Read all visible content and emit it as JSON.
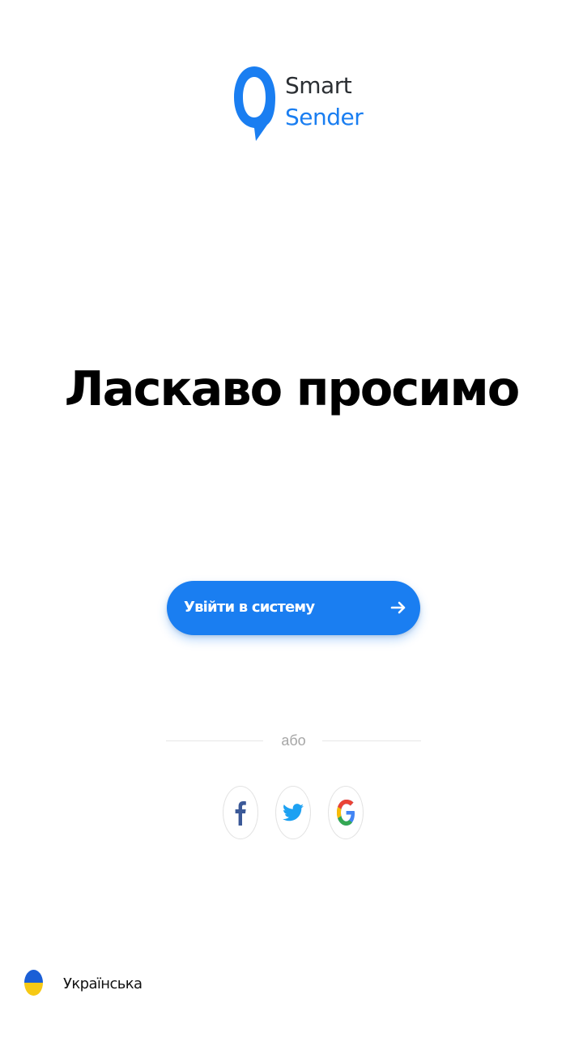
{
  "logo": {
    "line1": "Smart",
    "line2": "Sender",
    "icon": "speech-bubble-logo-icon",
    "brand_color": "#1a7ef1"
  },
  "headline": "Ласкаво просимо",
  "login_button": {
    "label": "Увійти в систему",
    "icon": "arrow-right-icon",
    "color": "#1a7ef1"
  },
  "divider": {
    "text": "або"
  },
  "social": [
    {
      "name": "facebook",
      "icon": "facebook-icon",
      "color": "#3b5998"
    },
    {
      "name": "twitter",
      "icon": "twitter-icon",
      "color": "#1da1f2"
    },
    {
      "name": "google",
      "icon": "google-icon",
      "colors": [
        "#4285f4",
        "#ea4335",
        "#fbbc05",
        "#34a853"
      ]
    }
  ],
  "language": {
    "label": "Українська",
    "icon": "ukraine-flag-icon",
    "flag_colors": [
      "#1b5fd6",
      "#f6c915"
    ]
  }
}
